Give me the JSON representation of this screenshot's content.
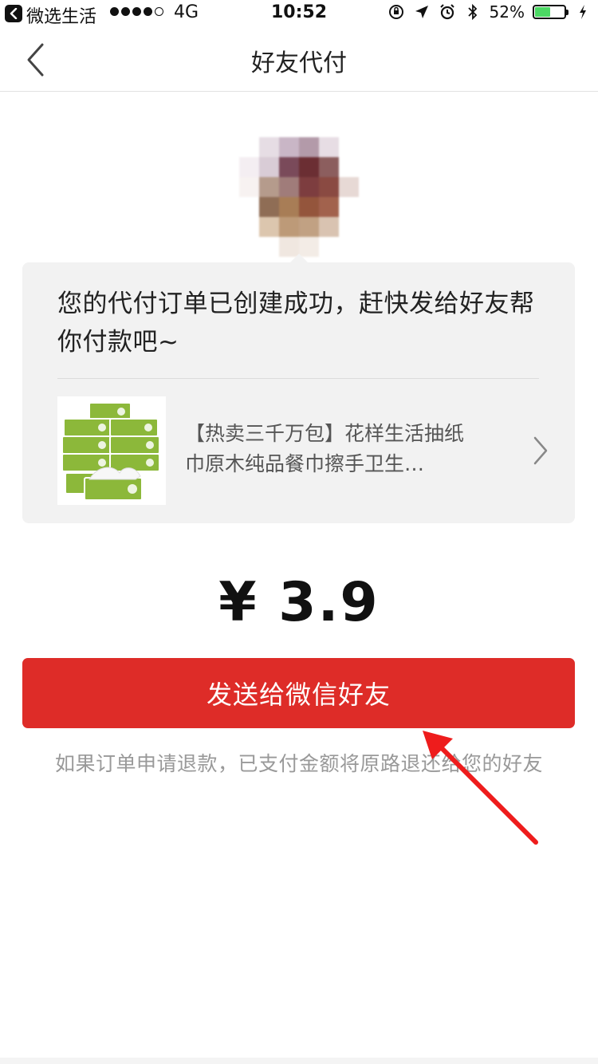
{
  "status_bar": {
    "back_app": "微选生活",
    "network": "4G",
    "time": "10:52",
    "battery_percent": "52%",
    "battery_level": 0.52,
    "signal_bars_filled": 4,
    "signal_bars_total": 5
  },
  "nav": {
    "title": "好友代付"
  },
  "card": {
    "message": "您的代付订单已创建成功，赶快发给好友帮你付款吧~",
    "product": {
      "title": "【热卖三千万包】花样生活抽纸巾原木纯品餐巾擦手卫生…"
    }
  },
  "price": "¥ 3.9",
  "send_button_label": "发送给微信好友",
  "refund_note": "如果订单申请退款，已支付金额将原路退还给您的好友",
  "colors": {
    "primary_button": "#de2c28",
    "annotation_arrow": "#ee1c1c",
    "product_green": "#8cb83a",
    "battery_green": "#4cd964"
  },
  "icons": {
    "back": "chevron-left-icon",
    "product_chevron": "chevron-right-icon",
    "status_back": "back-arrow-icon",
    "orientation_lock": "orientation-lock-icon",
    "location": "location-arrow-icon",
    "alarm": "alarm-clock-icon",
    "bluetooth": "bluetooth-icon",
    "charging": "charging-bolt-icon"
  }
}
